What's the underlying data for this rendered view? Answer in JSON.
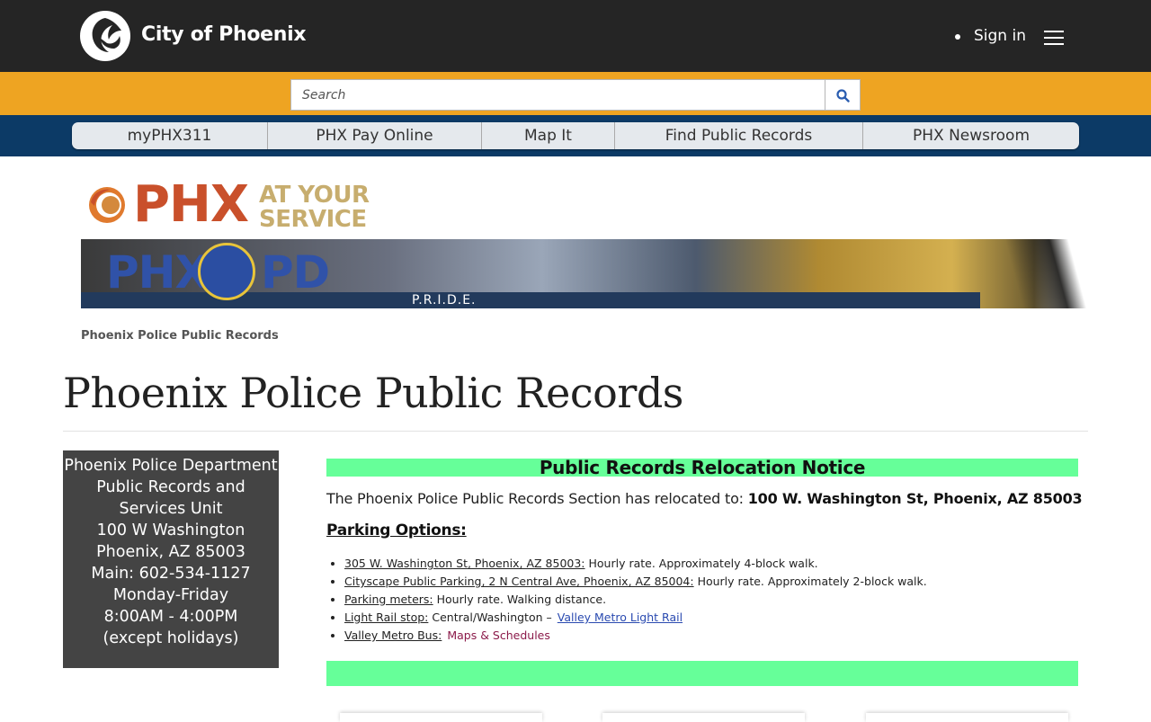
{
  "header": {
    "site_name": "City of Phoenix",
    "sign_in": "Sign in"
  },
  "search": {
    "placeholder": "Search"
  },
  "nav": {
    "items": [
      {
        "label": "myPHX311"
      },
      {
        "label": "PHX Pay Online"
      },
      {
        "label": "Map It"
      },
      {
        "label": "Find Public Records"
      },
      {
        "label": "PHX Newsroom"
      }
    ]
  },
  "brand": {
    "phx": "PHX",
    "at_your": "AT YOUR",
    "service": "SERVICE"
  },
  "banner": {
    "left": "PHX",
    "right": "PD",
    "motto": "P.R.I.D.E."
  },
  "breadcrumb": "Phoenix Police Public Records",
  "page_title": "Phoenix Police Public Records",
  "sidebar": {
    "lines": [
      "Phoenix Police Department",
      "Public Records and",
      "Services Unit",
      "100 W Washington",
      "Phoenix, AZ 85003",
      "Main: 602-534-1127",
      "Monday-Friday",
      "8:00AM - 4:00PM",
      "(except holidays)"
    ]
  },
  "notice": {
    "title": "Public Records Relocation Notice",
    "relocated_text": "The Phoenix Police Public Records Section has relocated to: ",
    "relocated_address": "100 W. Washington St, Phoenix, AZ 85003",
    "parking_title": "Parking Options:",
    "parking": [
      {
        "link": "305 W. Washington St, Phoenix, AZ 85003:",
        "text": " Hourly rate. Approximately 4-block walk."
      },
      {
        "link": "Cityscape Public Parking, 2 N Central Ave, Phoenix, AZ 85004:",
        "text": " Hourly rate. Approximately 2-block walk."
      },
      {
        "link": "Parking meters:",
        "text": " Hourly rate. Walking distance."
      },
      {
        "link": "Light Rail stop:",
        "text": " Central/Washington –",
        "extra_link": "Valley Metro Light Rail"
      },
      {
        "link": "Valley Metro Bus:",
        "text": "",
        "extra_link": "Maps & Schedules"
      }
    ]
  },
  "colors": {
    "header_bg": "#252525",
    "search_band": "#eea422",
    "nav_band": "#0c3a66",
    "notice_green": "#66ff99",
    "sidebar_bg": "#444444"
  }
}
